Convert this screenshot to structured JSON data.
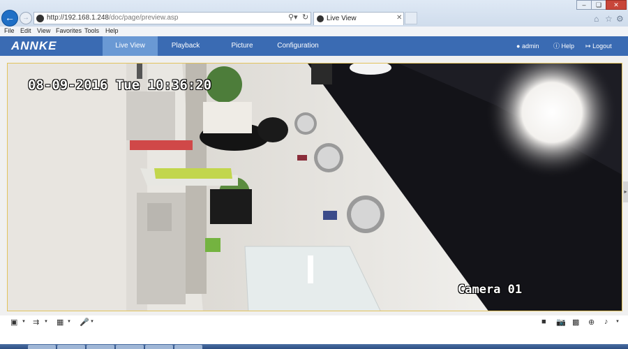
{
  "browser": {
    "url_host": "http://192.168.1.248",
    "url_path": "/doc/page/preview.asp",
    "tab_title": "Live View",
    "menu": [
      "File",
      "Edit",
      "View",
      "Favorites",
      "Tools",
      "Help"
    ]
  },
  "app": {
    "logo": "ANNKE",
    "tabs": {
      "live_view": "Live View",
      "playback": "Playback",
      "picture": "Picture",
      "configuration": "Configuration"
    },
    "user": "admin",
    "help": "Help",
    "logout": "Logout",
    "accent_color": "#3a6bb3",
    "active_tab_color": "#6a99d4"
  },
  "video": {
    "osd_timestamp": "08-09-2016 Tue 10:36:20",
    "osd_camera": "Camera 01"
  },
  "toolbar": {
    "left_icons": [
      "window-layout-icon",
      "stream-type-icon",
      "plugin-icon",
      "microphone-icon"
    ],
    "right_icons": [
      "stop-icon",
      "capture-icon",
      "record-icon",
      "digital-zoom-icon",
      "volume-icon"
    ]
  }
}
